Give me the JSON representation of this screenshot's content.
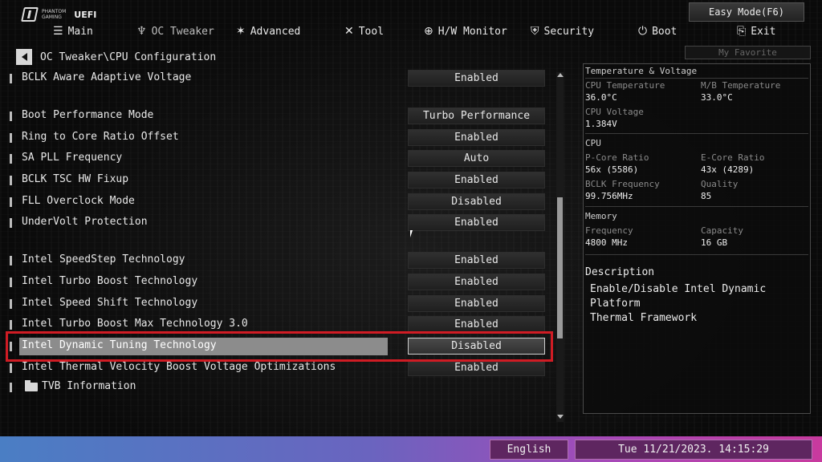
{
  "brand": {
    "line1": "PHANTOM",
    "line2": "GAMING",
    "uefi": "UEFI"
  },
  "easy_mode": "Easy Mode(F6)",
  "tabs": [
    {
      "label": "Main",
      "icon": "list-icon"
    },
    {
      "label": "OC Tweaker",
      "icon": "rocket-icon"
    },
    {
      "label": "Advanced",
      "icon": "star-icon"
    },
    {
      "label": "Tool",
      "icon": "wrench-icon"
    },
    {
      "label": "H/W Monitor",
      "icon": "monitor-icon"
    },
    {
      "label": "Security",
      "icon": "shield-icon"
    },
    {
      "label": "Boot",
      "icon": "power-icon"
    },
    {
      "label": "Exit",
      "icon": "exit-icon"
    }
  ],
  "breadcrumb": "OC Tweaker\\CPU Configuration",
  "my_favorite": "My Favorite",
  "settings": [
    {
      "label": "BCLK Aware Adaptive Voltage",
      "value": "Enabled"
    },
    {
      "label": "Boot Performance Mode",
      "value": "Turbo Performance"
    },
    {
      "label": "Ring to Core Ratio Offset",
      "value": "Enabled"
    },
    {
      "label": "SA PLL Frequency",
      "value": "Auto"
    },
    {
      "label": "BCLK TSC HW Fixup",
      "value": "Enabled"
    },
    {
      "label": "FLL Overclock Mode",
      "value": "Disabled"
    },
    {
      "label": "UnderVolt Protection",
      "value": "Enabled"
    },
    {
      "label": "Intel SpeedStep Technology",
      "value": "Enabled"
    },
    {
      "label": "Intel Turbo Boost Technology",
      "value": "Enabled"
    },
    {
      "label": "Intel Speed Shift Technology",
      "value": "Enabled"
    },
    {
      "label": "Intel Turbo Boost Max Technology 3.0",
      "value": "Enabled"
    },
    {
      "label": "Intel Dynamic Tuning Technology",
      "value": "Disabled"
    },
    {
      "label": "Intel Thermal Velocity Boost Voltage Optimizations",
      "value": "Enabled"
    }
  ],
  "submenu": {
    "label": "TVB Information"
  },
  "panel": {
    "title": "Temperature & Voltage",
    "cpu_temp_label": "CPU Temperature",
    "cpu_temp": "36.0°C",
    "mb_temp_label": "M/B Temperature",
    "mb_temp": "33.0°C",
    "cpu_voltage_label": "CPU Voltage",
    "cpu_voltage": "1.384V",
    "cpu_section": "CPU",
    "pcore_label": "P-Core Ratio",
    "pcore": "56x (5586)",
    "ecore_label": "E-Core Ratio",
    "ecore": "43x (4289)",
    "bclk_label": "BCLK Frequency",
    "bclk": "99.756MHz",
    "quality_label": "Quality",
    "quality": "85",
    "memory_section": "Memory",
    "freq_label": "Frequency",
    "freq": "4800 MHz",
    "cap_label": "Capacity",
    "cap": "16 GB",
    "desc_title": "Description",
    "desc_body": "Enable/Disable Intel Dynamic Platform\nThermal Framework"
  },
  "bottom": {
    "language": "English",
    "datetime": "Tue 11/21/2023. 14:15:29"
  },
  "colors": {
    "highlight": "#d01c24",
    "bottom_start": "#4a7ec4",
    "bottom_end": "#c83a9e"
  }
}
